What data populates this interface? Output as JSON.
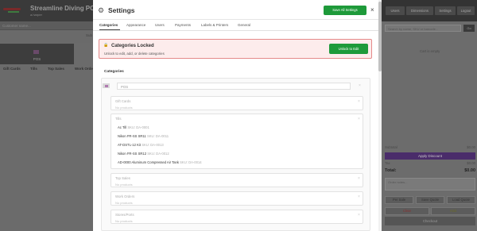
{
  "app": {
    "title": "Streamline Diving POS",
    "user": "a.harper",
    "customer_placeholder": "Customer name...",
    "sub_label": "Sub",
    "pos_tile": "POS",
    "categories": [
      "Gift Cards",
      "Tills",
      "Top Sales",
      "Work Orde"
    ]
  },
  "right": {
    "buttons": [
      "Users",
      "Dimensions",
      "Settings",
      "Logout"
    ],
    "search_placeholder": "Search by name, SKU or barcode...",
    "go": "Go",
    "cart_empty": "Cart is empty",
    "subtotal_label": "Subtotal",
    "subtotal_value": "$0.00",
    "discount_label": "Apply Discount",
    "tax_label": "Tax",
    "tax_value": "$0.00",
    "total_label": "Total:",
    "total_value": "$0.00",
    "notes_placeholder": "Order notes...",
    "actions": [
      "Per Sale",
      "Save Quote",
      "Load Quote"
    ],
    "clear": "Clear",
    "hold": "Hold",
    "checkout": "Checkout"
  },
  "modal": {
    "title": "Settings",
    "save_all": "Save All Settings",
    "close": "×",
    "tabs": [
      "Categories",
      "Appearance",
      "Users",
      "Payments",
      "Labels & Printers",
      "General"
    ],
    "active_tab": 0,
    "banner": {
      "title": "Categories Locked",
      "subtitle": "Unlock to edit, add, or delete categories",
      "unlock": "Unlock to Edit"
    },
    "section_label": "Categories",
    "root": "POS",
    "categories": [
      {
        "name": "Gift Cards",
        "note": "No products"
      },
      {
        "name": "Tills",
        "products": [
          {
            "name": "Ac Till",
            "sku": "SKU: DA-0001"
          },
          {
            "name": "Nikon FR-SS SR11",
            "sku": "SKU: DA-0011"
          },
          {
            "name": "AT-DSTL-12 Kit",
            "sku": "SKU: DA-0013"
          },
          {
            "name": "Nikon FR-SS SR12",
            "sku": "SKU: DA-0012"
          },
          {
            "name": "AD-0000 Aluminum Compressed Air Tank",
            "sku": "SKU: DA-0014"
          }
        ]
      },
      {
        "name": "Top Sales",
        "note": "No products"
      },
      {
        "name": "Work Orders",
        "note": "No products"
      },
      {
        "name": "Stores/Ports",
        "note": "No products"
      }
    ]
  }
}
